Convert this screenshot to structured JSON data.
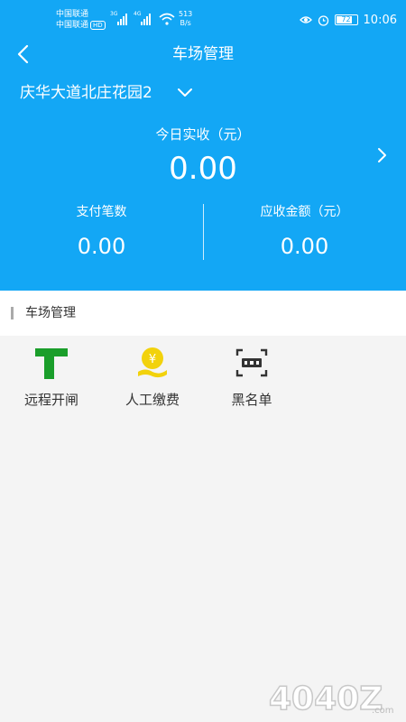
{
  "status": {
    "carrier_1": "中国联通",
    "carrier_2": "中国联通",
    "hd": "HD",
    "net_1": "3G",
    "net_2": "4G",
    "speed_value": "513",
    "speed_unit": "B/s",
    "battery": "72",
    "time": "10:06"
  },
  "nav": {
    "title": "车场管理"
  },
  "lot": {
    "name": "庆华大道北庄花园2"
  },
  "summary": {
    "today_label": "今日实收（元）",
    "today_value": "0.00",
    "payments_label": "支付笔数",
    "payments_value": "0.00",
    "receivable_label": "应收金额（元）",
    "receivable_value": "0.00"
  },
  "section": {
    "title": "车场管理"
  },
  "tiles": [
    {
      "label": "远程开闸",
      "icon": "gate-icon",
      "color": "#1a9e2a"
    },
    {
      "label": "人工缴费",
      "icon": "coin-hand-icon",
      "color": "#f2d20c"
    },
    {
      "label": "黑名单",
      "icon": "plate-scan-icon",
      "color": "#333333"
    }
  ],
  "watermark": {
    "text": "4040Z",
    "suffix": ".com"
  },
  "colors": {
    "header": "#13a7f5",
    "background": "#f4f4f4"
  }
}
